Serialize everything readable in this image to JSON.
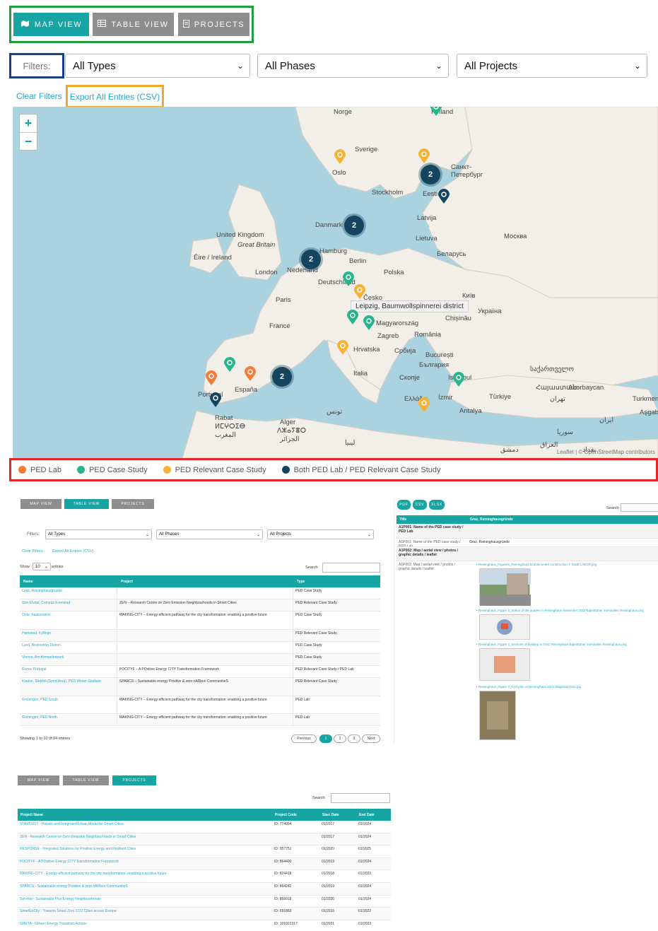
{
  "tabs": [
    {
      "label": "MAP VIEW",
      "icon": "map-icon",
      "active": true
    },
    {
      "label": "TABLE VIEW",
      "icon": "table-icon",
      "active": false
    },
    {
      "label": "PROJECTS",
      "icon": "document-icon",
      "active": false
    }
  ],
  "filters": {
    "label": "Filters:",
    "types": "All Types",
    "phases": "All Phases",
    "projects": "All Projects"
  },
  "actions": {
    "clear": "Clear Filters",
    "export": "Export All Entries (CSV)"
  },
  "map": {
    "places": [
      "Norge",
      "Finland",
      "Sverige",
      "Oslo",
      "Stockholm",
      "Санкт-Петербург",
      "Eesti",
      "Latvija",
      "Lietuva",
      "Danmark",
      "Москва",
      "United Kingdom",
      "Great Britain",
      "Éire / Ireland",
      "Hamburg",
      "Berlin",
      "Беларусь",
      "Polska",
      "London",
      "Nederland",
      "Deutschland",
      "Paris",
      "Česko",
      "Київ",
      "Україна",
      "France",
      "Magyarország",
      "Chișinău",
      "Zagreb",
      "România",
      "Hrvatska",
      "Србија",
      "București",
      "България",
      "España",
      "Italia",
      "Скопје",
      "Portugal",
      "Rabat",
      "ⵍⵎⵖⵔⵉⴱ",
      "المغرب",
      "Alger",
      "ⴷⵣⴰⵢⴻⵔ",
      "الجزائر",
      "تونس",
      "Ελλάδα",
      "İzmir",
      "Istanbul",
      "Türkiye",
      "Antalya",
      "საქართველო",
      "Հայաստան",
      "Azərbaycan",
      "Turkmenistan",
      "Aşgabat",
      "تهران",
      "ایران",
      "سوريا",
      "العراق",
      "دمشق",
      "بغداد",
      "ليبيا"
    ],
    "tooltip": "Leipzig, Baumwollspinnerei district",
    "zoom_in": "+",
    "zoom_out": "−",
    "cluster_label": "2",
    "attribution": "Leaflet | © OpenStreetMap contributors"
  },
  "legend": [
    {
      "label": "PED Lab",
      "color": "#f37c3a"
    },
    {
      "label": "PED Case Study",
      "color": "#26b58c"
    },
    {
      "label": "PED Relevant Case Study",
      "color": "#f5b335"
    },
    {
      "label": "Both PED Lab / PED Relevant Case Study",
      "color": "#15445f"
    }
  ],
  "table_view": {
    "tabs": [
      "MAP VIEW",
      "TABLE VIEW",
      "PROJECTS"
    ],
    "filters_label": "Filters:",
    "types": "All Types",
    "phases": "All Phases",
    "projects": "All Projects",
    "clear": "Clear Filters",
    "export": "Export All Entries (CSV)",
    "show": "Show",
    "show_count": "10",
    "entries": "entries",
    "search": "Search:",
    "columns": [
      "Name",
      "Project",
      "Type"
    ],
    "rows": [
      [
        "Graz, Reininghausgründe",
        "",
        "PED Case Study"
      ],
      [
        "Stor-Elvdal, Campus Evenstad",
        "ZEN – Research Centre on Zero Emission Neighbourhoods in Smart Cities",
        "PED Relevant Case Study"
      ],
      [
        "Oulu, Kaukovainio",
        "MAKING-CITY – Energy efficient pathway for the city transformation: enabling a positive future",
        "PED Case Study"
      ],
      [
        "Halmstad, Fyllinge",
        "",
        "PED Relevant Case Study"
      ],
      [
        "Lund, Brunnshög District",
        "",
        "PED Case Study"
      ],
      [
        "Vienna, Am Kempelenpark",
        "",
        "PED Case Study"
      ],
      [
        "Évora, Portugal",
        "POCITYF – A POsitive Energy CITY Transformation Framework",
        "PED Relevant Case Study / PED Lab"
      ],
      [
        "Kladno, Sletiště (Sport Area), PED Winter Stadium",
        "SPARCS – Sustainable energy Positive & zero cARbon CommunitieS",
        "PED Relevant Case Study"
      ],
      [
        "Groningen, PED South",
        "MAKING-CITY – Energy efficient pathway for the city transformation: enabling a positive future",
        "PED Lab"
      ],
      [
        "Groningen, PED North",
        "MAKING-CITY – Energy efficient pathway for the city transformation: enabling a positive future",
        "PED Lab"
      ]
    ],
    "footer": "Showing 1 to 10 of 24 entries",
    "pager": [
      "Previous",
      "1",
      "2",
      "3",
      "Next"
    ]
  },
  "detail_view": {
    "buttons": [
      "PDF",
      "CSV",
      "XLSX"
    ],
    "search": "Search:",
    "columns": [
      "Title",
      "Graz, Reininghausgründe"
    ],
    "rows": [
      [
        "A1P001: Name of the PED case study / PED Lab",
        ""
      ],
      [
        "A1P001: Name of the PED case study / PED Lab",
        "Graz, Reininghausgründe"
      ],
      [
        "A1P002: Map / aerial view / photos / graphic details / leaflet",
        ""
      ],
      [
        "A1P002: Map / aerial view / photos / graphic details / leaflet",
        ""
      ]
    ],
    "links": [
      "Reininghaus_Figure 6_Reininghaus Gründe under construction © Stadt LABOR.png",
      "Reininghaus_Figure 5_Status of the quarter in Reininghaus November 2022 Eigentümer Immobilien Reininghaus.png",
      "Reininghaus_Figure 4_Sections of building in Graz Reininghaus Eigentümer Immobilien Reininghaus.png",
      "Reininghaus_Figure 3_Grid plan of Reininghaus 2021 Magistrat Graz.jpg"
    ]
  },
  "projects_view": {
    "tabs": [
      "MAP VIEW",
      "TABLE VIEW",
      "PROJECTS"
    ],
    "search": "Search:",
    "columns": [
      "Project Name",
      "Project Code",
      "Start Date",
      "End Date"
    ],
    "rows": [
      [
        "STARDUST - Holistic and Integrated Urban Model for Smart Cities",
        "ID: 774094",
        "01/2017",
        "01/2024"
      ],
      [
        "ZEN - Research Centre on Zero Emission Neighbourhoods in Smart Cities",
        "",
        "01/2017",
        "01/2024"
      ],
      [
        "RESPONSE - Integrated Solutions for Positive Energy and Resilient Cities",
        "ID: 957751",
        "01/2020",
        "01/2025"
      ],
      [
        "POCITYF - A POsitive Energy CITY Transformation Framework",
        "ID: 864400",
        "01/2019",
        "01/2024"
      ],
      [
        "MAKING-CITY - Energy efficient pathway for the city transformation: enabling a positive future",
        "ID: 824418",
        "01/2018",
        "01/2023"
      ],
      [
        "SPARCS - Sustainable energy Positive & zero cARbon CommunitieS",
        "ID: 864242",
        "01/2019",
        "01/2024"
      ],
      [
        "Syn-ikia - Sustainable Plus Energy Neighbourhoods",
        "ID: 869918",
        "01/2020",
        "01/2024"
      ],
      [
        "SmartEnCity - Towards Smart Zero CO2 Cities across Europe",
        "ID: 691883",
        "01/2016",
        "01/2022"
      ],
      [
        "GRETA - GReen Energy Transition Actions",
        "ID: 101022317",
        "01/2021",
        "01/2023"
      ]
    ]
  }
}
